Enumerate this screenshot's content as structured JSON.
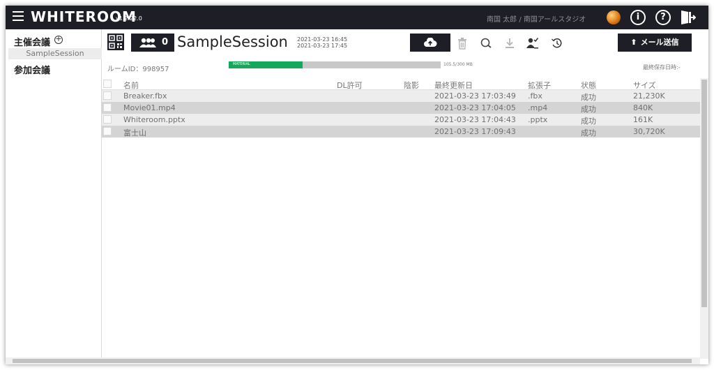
{
  "app": {
    "logo": "WHITEROOM",
    "version": "v1.2.22.0"
  },
  "header": {
    "user": "南国 太郎 / 南国アールスタジオ"
  },
  "sidebar": {
    "host_label": "主催会議",
    "host_add_symbol": "+",
    "sessions": [
      "SampleSession"
    ],
    "join_label": "参加会議"
  },
  "session": {
    "title": "SampleSession",
    "member_count": "0",
    "start": "2021-03-23 16:45",
    "end": "2021-03-23 17:45",
    "room_id": "ルームID：998957",
    "storage_label": "MATERIAL",
    "storage_text": "105.5/300 MB",
    "storage_fraction": 0.35,
    "last_saved": "最終保存日時:-"
  },
  "toolbar": {
    "mail_label": "メール送信",
    "icons": [
      "cloud-upload-icon",
      "trash-icon",
      "search-icon",
      "download-icon",
      "user-check-icon",
      "history-icon"
    ]
  },
  "table": {
    "columns": {
      "name": "名前",
      "dl": "DL許可",
      "shadow": "陰影",
      "updated": "最終更新日",
      "ext": "拡張子",
      "status": "状態",
      "size": "サイズ"
    },
    "rows": [
      {
        "name": "Breaker.fbx",
        "updated": "2021-03-23 17:03:49",
        "ext": ".fbx",
        "status": "成功",
        "size": "21,230K"
      },
      {
        "name": "Movie01.mp4",
        "updated": "2021-03-23 17:04:05",
        "ext": ".mp4",
        "status": "成功",
        "size": "840K"
      },
      {
        "name": "Whiteroom.pptx",
        "updated": "2021-03-23 17:04:43",
        "ext": ".pptx",
        "status": "成功",
        "size": "161K"
      },
      {
        "name": "富士山",
        "updated": "2021-03-23 17:09:43",
        "ext": "",
        "status": "成功",
        "size": "30,720K"
      }
    ]
  },
  "colors": {
    "dark": "#1e1f26",
    "progress": "#13a85a",
    "row_odd": "#ededed",
    "row_even": "#d4d4d4"
  }
}
